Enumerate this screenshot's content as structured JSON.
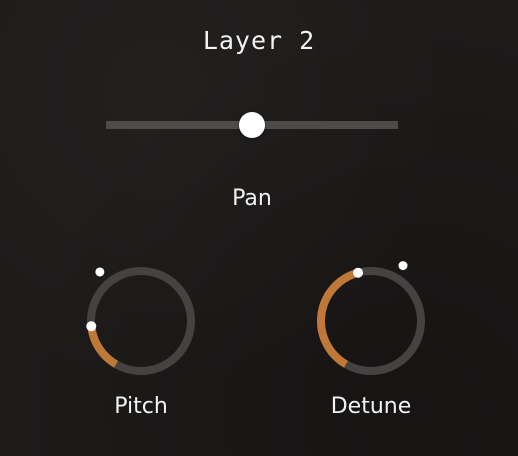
{
  "layer": {
    "title": "Layer 2"
  },
  "pan": {
    "label": "Pan",
    "value": 0.5
  },
  "knobs": [
    {
      "label": "Pitch",
      "value": 0.18,
      "indicator_angle_deg": -35
    },
    {
      "label": "Detune",
      "value": 0.45,
      "indicator_angle_deg": 10
    }
  ],
  "colors": {
    "background": "#1d1b1a",
    "track": "#4e4c4a",
    "accent": "#c07838",
    "knob_ring": "#444342",
    "thumb": "#ffffff"
  }
}
